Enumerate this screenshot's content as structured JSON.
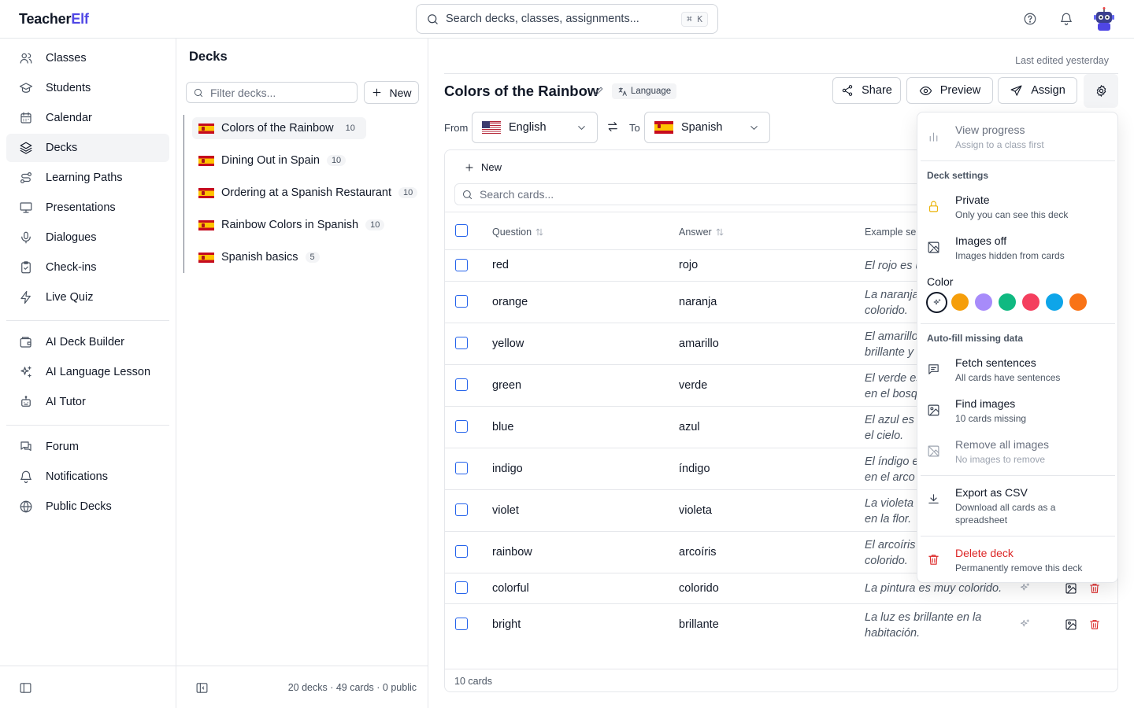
{
  "app": {
    "name_part1": "Teacher",
    "name_part2": "Elf"
  },
  "search": {
    "placeholder": "Search decks, classes, assignments...",
    "shortcut": "⌘ K"
  },
  "sidebar": {
    "items": [
      {
        "label": "Classes",
        "icon": "users-icon"
      },
      {
        "label": "Students",
        "icon": "graduation-cap-icon"
      },
      {
        "label": "Calendar",
        "icon": "calendar-icon"
      },
      {
        "label": "Decks",
        "icon": "layers-icon",
        "active": true
      },
      {
        "label": "Learning Paths",
        "icon": "route-icon"
      },
      {
        "label": "Presentations",
        "icon": "presentation-icon"
      },
      {
        "label": "Dialogues",
        "icon": "microphone-icon"
      },
      {
        "label": "Check-ins",
        "icon": "clipboard-check-icon"
      },
      {
        "label": "Live Quiz",
        "icon": "bolt-icon"
      },
      {
        "label": "AI Deck Builder",
        "icon": "wallet-icon"
      },
      {
        "label": "AI Language Lesson",
        "icon": "sparkles-icon"
      },
      {
        "label": "AI Tutor",
        "icon": "bot-icon"
      },
      {
        "label": "Forum",
        "icon": "chat-icon"
      },
      {
        "label": "Notifications",
        "icon": "bell-icon"
      },
      {
        "label": "Public Decks",
        "icon": "globe-icon"
      }
    ]
  },
  "decks_panel": {
    "title": "Decks",
    "filter_placeholder": "Filter decks...",
    "new_label": "New",
    "items": [
      {
        "name": "Colors of the Rainbow",
        "count": "10"
      },
      {
        "name": "Dining Out in Spain",
        "count": "10"
      },
      {
        "name": "Ordering at a Spanish Restaurant",
        "count": "10"
      },
      {
        "name": "Rainbow Colors in Spanish",
        "count": "10"
      },
      {
        "name": "Spanish basics",
        "count": "5"
      }
    ],
    "footer": "20 decks · 49 cards · 0 public"
  },
  "main": {
    "last_edited": "Last edited yesterday",
    "deck_title": "Colors of the Rainbow",
    "badge": "Language",
    "buttons": {
      "share": "Share",
      "preview": "Preview",
      "assign": "Assign"
    },
    "from_label": "From",
    "to_label": "To",
    "from_lang": "English",
    "to_lang": "Spanish",
    "new_card": "New",
    "search_cards_placeholder": "Search cards...",
    "columns": {
      "question": "Question",
      "answer": "Answer",
      "example": "Example se"
    },
    "rows": [
      {
        "q": "red",
        "a": "rojo",
        "ex1": "El rojo es u",
        "ex2": ""
      },
      {
        "q": "orange",
        "a": "naranja",
        "ex1": "La naranja",
        "ex2": "colorido."
      },
      {
        "q": "yellow",
        "a": "amarillo",
        "ex1": "El amarillo",
        "ex2": "brillante y"
      },
      {
        "q": "green",
        "a": "verde",
        "ex1": "El verde es",
        "ex2": "en el bosq"
      },
      {
        "q": "blue",
        "a": "azul",
        "ex1": "El azul es d",
        "ex2": "el cielo."
      },
      {
        "q": "indigo",
        "a": "índigo",
        "ex1": "El índigo e",
        "ex2": "en el arco"
      },
      {
        "q": "violet",
        "a": "violeta",
        "ex1": "La violeta",
        "ex2": "en la flor."
      },
      {
        "q": "rainbow",
        "a": "arcoíris",
        "ex1": "El arcoíris",
        "ex2": "colorido."
      },
      {
        "q": "colorful",
        "a": "colorido",
        "ex1": "La pintura es muy colorido.",
        "ex2": ""
      },
      {
        "q": "bright",
        "a": "brillante",
        "ex1": "La luz es brillante en la",
        "ex2": "habitación."
      }
    ],
    "footer": "10 cards"
  },
  "menu": {
    "view_progress": {
      "title": "View progress",
      "sub": "Assign to a class first"
    },
    "deck_settings_label": "Deck settings",
    "private": {
      "title": "Private",
      "sub": "Only you can see this deck"
    },
    "images_off": {
      "title": "Images off",
      "sub": "Images hidden from cards"
    },
    "color_label": "Color",
    "colors": [
      "none",
      "#f59e0b",
      "#a78bfa",
      "#10b981",
      "#f43f5e",
      "#0ea5e9",
      "#f97316"
    ],
    "autofill_label": "Auto-fill missing data",
    "fetch_sentences": {
      "title": "Fetch sentences",
      "sub": "All cards have sentences"
    },
    "find_images": {
      "title": "Find images",
      "sub": "10 cards missing"
    },
    "remove_images": {
      "title": "Remove all images",
      "sub": "No images to remove"
    },
    "export_csv": {
      "title": "Export as CSV",
      "sub": "Download all cards as a spreadsheet"
    },
    "delete_deck": {
      "title": "Delete deck",
      "sub": "Permanently remove this deck"
    }
  }
}
